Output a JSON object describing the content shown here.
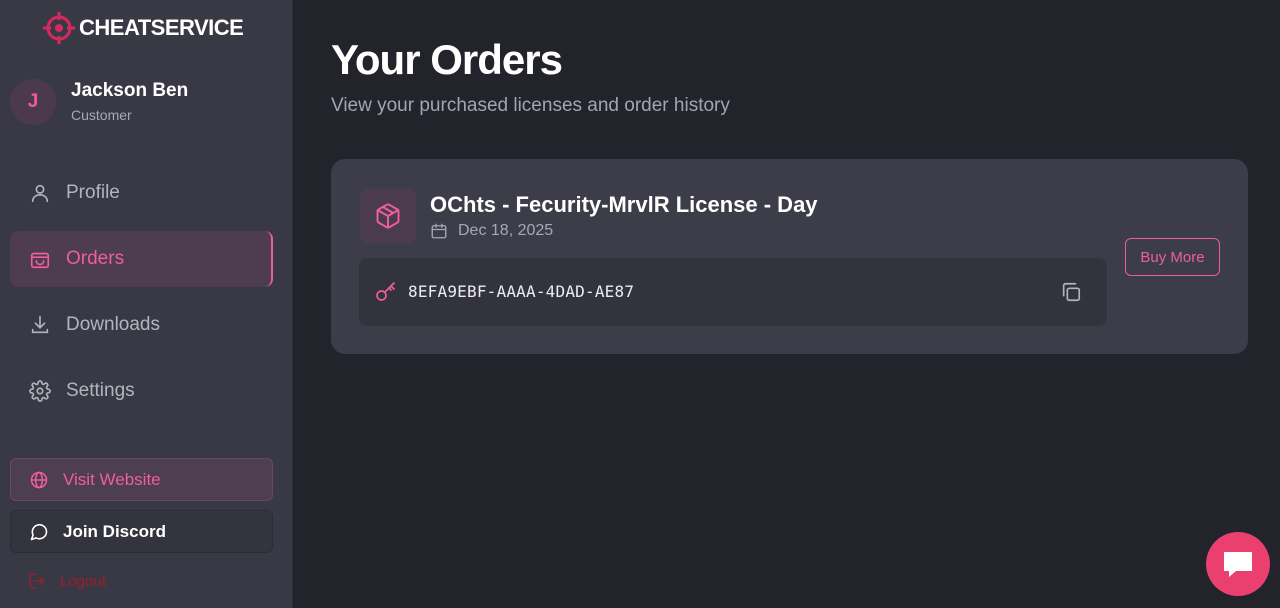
{
  "brand": {
    "logo_text": "CHEATSERVICE",
    "accent_color": "#ef5d9b"
  },
  "user": {
    "initial": "J",
    "name": "Jackson Ben",
    "role": "Customer"
  },
  "nav": {
    "items": [
      {
        "label": "Profile",
        "icon": "user-icon",
        "active": false
      },
      {
        "label": "Orders",
        "icon": "shopping-bag-icon",
        "active": true
      },
      {
        "label": "Downloads",
        "icon": "download-icon",
        "active": false
      },
      {
        "label": "Settings",
        "icon": "gear-icon",
        "active": false
      }
    ]
  },
  "sidebar_actions": {
    "visit_website": "Visit Website",
    "join_discord": "Join Discord",
    "logout": "Logout"
  },
  "page": {
    "title": "Your Orders",
    "subtitle": "View your purchased licenses and order history"
  },
  "orders": [
    {
      "product_name": "OChts - Fecurity-MrvlR License - Day",
      "date": "Dec 18, 2025",
      "license_key": "8EFA9EBF-AAAA-4DAD-AE87",
      "buy_more_label": "Buy More"
    }
  ]
}
